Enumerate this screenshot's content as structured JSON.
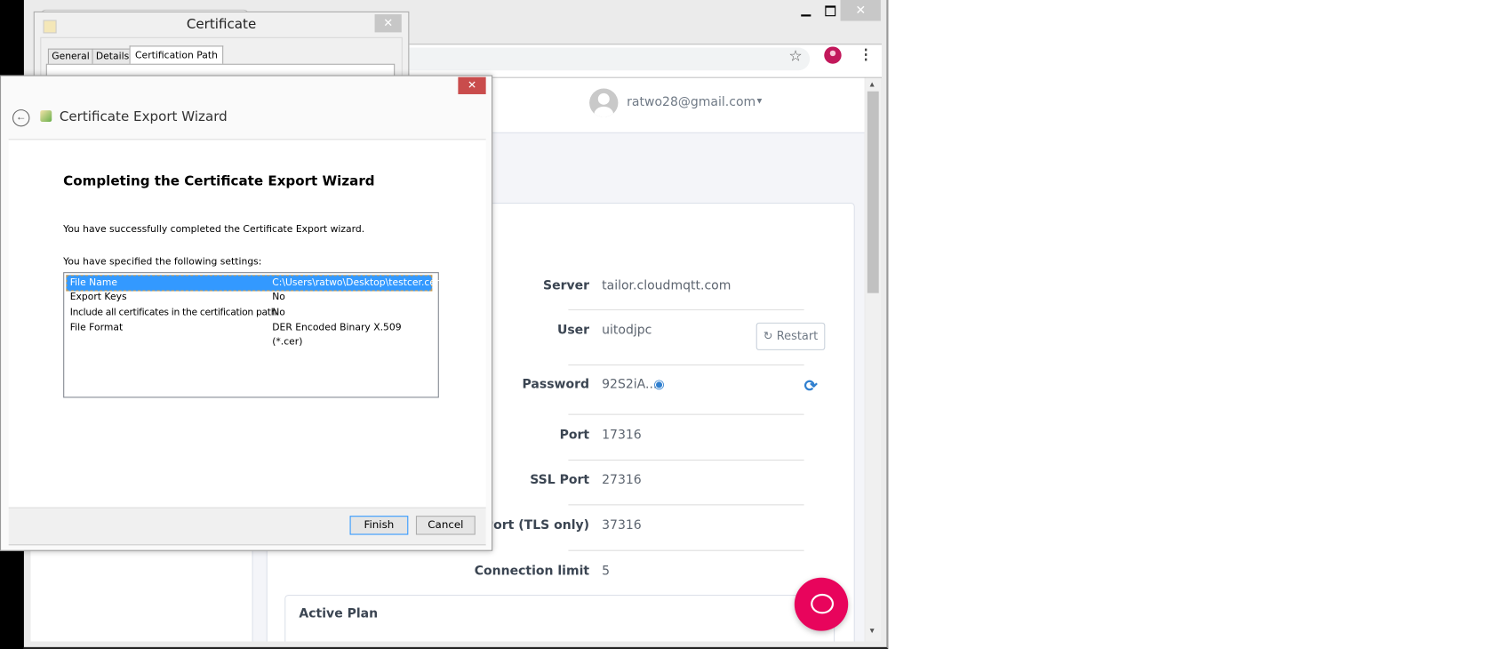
{
  "browser": {
    "minimize_icon": "minimize-icon",
    "maximize_icon": "maximize-icon",
    "close_icon": "close-icon",
    "close_label": "✕"
  },
  "site": {
    "user_email": "ratwo28@gmail.com",
    "details": [
      {
        "label": "Server",
        "value": "tailor.cloudmqtt.com"
      },
      {
        "label": "User",
        "value": "uitodjpc"
      },
      {
        "label": "Password",
        "value": "92S2iA..."
      },
      {
        "label": "Port",
        "value": "17316"
      },
      {
        "label": "SSL Port",
        "value": "27316"
      },
      {
        "label": "s Port (TLS only)",
        "value": "37316"
      },
      {
        "label": "Connection limit",
        "value": "5"
      }
    ],
    "restart_label": "Restart",
    "active_plan_title": "Active Plan",
    "brand_color": "#e8045c",
    "accent_color": "#2f7fcf"
  },
  "certificate_dialog": {
    "title": "Certificate",
    "tabs": [
      "General",
      "Details",
      "Certification Path"
    ],
    "active_tab": "Certification Path"
  },
  "wizard": {
    "title": "Certificate Export Wizard",
    "heading": "Completing the Certificate Export Wizard",
    "message": "You have successfully completed the Certificate Export wizard.",
    "settings_label": "You have specified the following settings:",
    "settings": [
      {
        "name": "File Name",
        "value": "C:\\Users\\ratwo\\Desktop\\testcer.cer",
        "selected": true
      },
      {
        "name": "Export Keys",
        "value": "No"
      },
      {
        "name": "Include all certificates in the certification path",
        "value": "No"
      },
      {
        "name": "File Format",
        "value": "DER Encoded Binary X.509 (*.cer)"
      }
    ],
    "finish_label": "Finish",
    "cancel_label": "Cancel"
  }
}
